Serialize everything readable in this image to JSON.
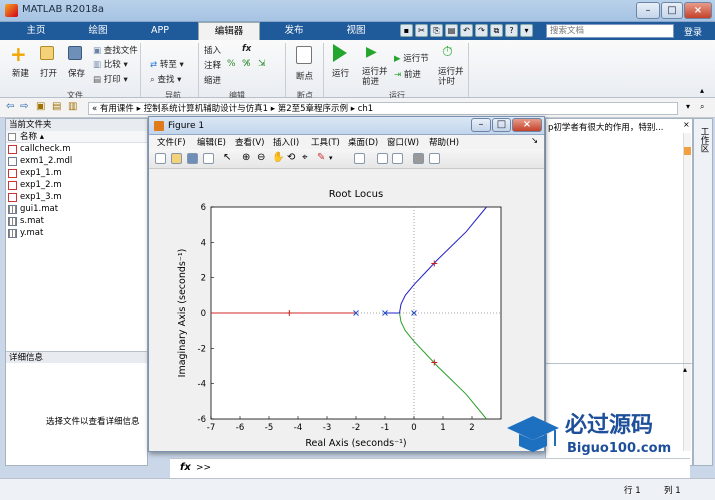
{
  "window": {
    "title": "MATLAB R2018a"
  },
  "tabs": [
    {
      "label": "主页"
    },
    {
      "label": "绘图"
    },
    {
      "label": "APP"
    },
    {
      "label": "编辑器",
      "active": true
    },
    {
      "label": "发布"
    },
    {
      "label": "视图"
    }
  ],
  "search": {
    "placeholder": "搜索文档",
    "login": "登录"
  },
  "ribbon": {
    "file": {
      "new": "新建",
      "open": "打开",
      "save": "保存",
      "find_files": "查找文件",
      "compare": "比较",
      "print": "打印",
      "group": "文件"
    },
    "navigate": {
      "goto": "转至",
      "find": "查找",
      "group": "导航"
    },
    "edit": {
      "insert": "插入",
      "fx": "fx",
      "comment": "注释",
      "indent": "缩进",
      "group": "编辑"
    },
    "breakpoints": {
      "label": "断点",
      "group": "断点"
    },
    "run": {
      "run": "运行",
      "run_advance": "运行并\n前进",
      "run_section": "运行节",
      "advance": "前进",
      "run_time": "运行并\n计时",
      "group": "运行"
    }
  },
  "address": {
    "path": [
      "有用课件",
      "控制系统计算机辅助设计与仿真1",
      "第2至5章程序示例",
      "ch1"
    ]
  },
  "left_panel": {
    "title": "当前文件夹",
    "name_col": "名称",
    "files": [
      {
        "name": "callcheck.m",
        "kind": "m"
      },
      {
        "name": "exm1_2.mdl",
        "kind": "mdl"
      },
      {
        "name": "exp1_1.m",
        "kind": "m"
      },
      {
        "name": "exp1_2.m",
        "kind": "m"
      },
      {
        "name": "exp1_3.m",
        "kind": "m"
      },
      {
        "name": "gui1.mat",
        "kind": "mat"
      },
      {
        "name": "s.mat",
        "kind": "mat"
      },
      {
        "name": "y.mat",
        "kind": "mat"
      }
    ],
    "details_title": "详细信息",
    "details_hint": "选择文件以查看详细信息"
  },
  "right_panel": {
    "text": "p初学者有很大的作用，特别...",
    "strip_label": "工作区"
  },
  "figure": {
    "title": "Figure 1",
    "menu": [
      "文件(F)",
      "编辑(E)",
      "查看(V)",
      "插入(I)",
      "工具(T)",
      "桌面(D)",
      "窗口(W)",
      "帮助(H)"
    ]
  },
  "chart_data": {
    "type": "line",
    "title": "Root Locus",
    "xlabel": "Real Axis (seconds⁻¹)",
    "ylabel": "Imaginary Axis (seconds⁻¹)",
    "xlim": [
      -7,
      3
    ],
    "ylim": [
      -6,
      6
    ],
    "xticks": [
      -7,
      -6,
      -5,
      -4,
      -3,
      -2,
      -1,
      0,
      1,
      2
    ],
    "yticks": [
      -6,
      -4,
      -2,
      0,
      2,
      4,
      6
    ],
    "grid": false,
    "series": [
      {
        "color": "#d62728",
        "points": [
          [
            -7,
            0
          ],
          [
            -2,
            0
          ]
        ]
      },
      {
        "color": "#1f1fc8",
        "points": [
          [
            -1,
            0
          ],
          [
            -0.5,
            0.0
          ],
          [
            -0.45,
            0.5
          ],
          [
            -0.3,
            1.0
          ],
          [
            0.0,
            1.6
          ],
          [
            0.4,
            2.3
          ],
          [
            0.8,
            3.0
          ],
          [
            1.3,
            3.8
          ],
          [
            1.8,
            4.6
          ],
          [
            2.5,
            6.0
          ]
        ]
      },
      {
        "color": "#2ca02c",
        "points": [
          [
            -0.5,
            0.0
          ],
          [
            -0.45,
            -0.5
          ],
          [
            -0.3,
            -1.0
          ],
          [
            0.0,
            -1.6
          ],
          [
            0.4,
            -2.3
          ],
          [
            0.8,
            -3.0
          ],
          [
            1.3,
            -3.8
          ],
          [
            1.8,
            -4.6
          ],
          [
            2.5,
            -6.0
          ]
        ]
      }
    ],
    "poles": [
      [
        0,
        0
      ],
      [
        -1,
        0
      ],
      [
        -2,
        0
      ]
    ],
    "markers": [
      [
        -4.3,
        0
      ],
      [
        0.7,
        2.8
      ],
      [
        0.7,
        -2.8
      ]
    ]
  },
  "cmd": {
    "fx": "fx",
    "prompt": ">>"
  },
  "status": {
    "row": "行  1",
    "col": "列  1"
  },
  "watermark": {
    "cn": "必过源码",
    "url": "Biguo100.com"
  }
}
